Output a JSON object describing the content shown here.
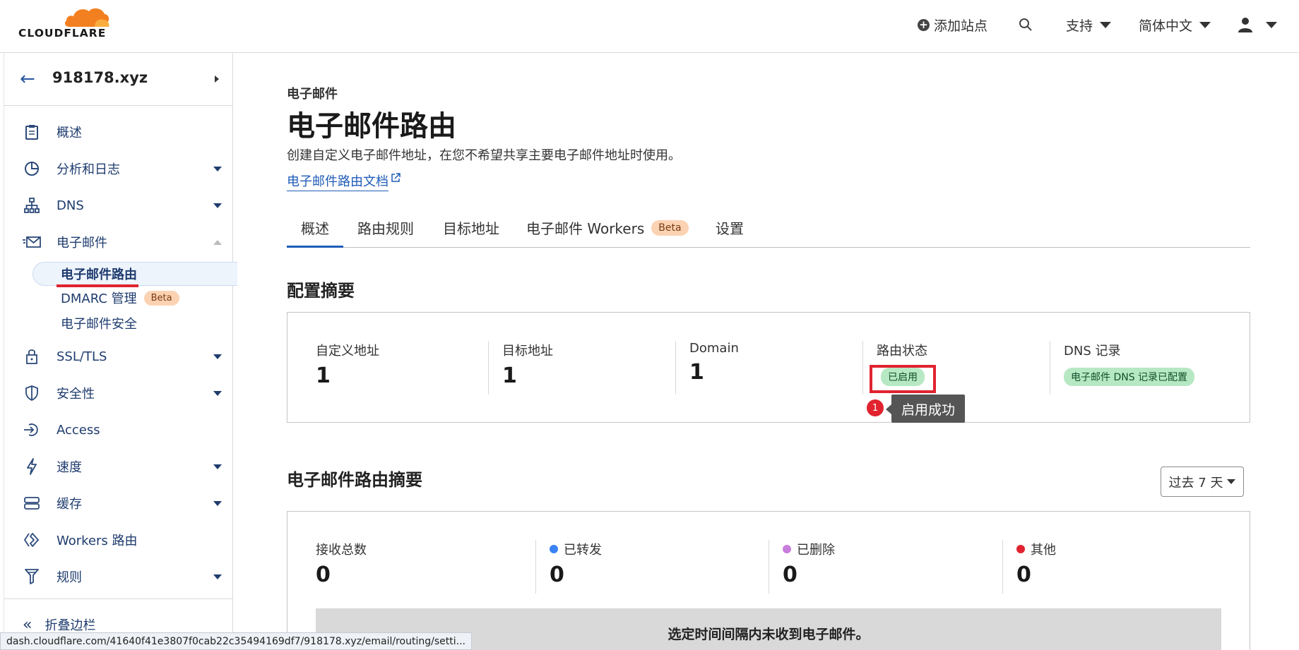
{
  "header": {
    "logo_text": "CLOUDFLARE",
    "add_site_label": "添加站点",
    "support_label": "支持",
    "language_label": "简体中文"
  },
  "sidebar": {
    "zone_name": "918178.xyz",
    "items": [
      {
        "label": "概述",
        "icon": "clipboard-icon"
      },
      {
        "label": "分析和日志",
        "icon": "analytics-icon"
      },
      {
        "label": "DNS",
        "icon": "network-icon"
      },
      {
        "label": "电子邮件",
        "icon": "email-icon"
      },
      {
        "label": "SSL/TLS",
        "icon": "lock-icon"
      },
      {
        "label": "安全性",
        "icon": "shield-icon"
      },
      {
        "label": "Access",
        "icon": "access-icon"
      },
      {
        "label": "速度",
        "icon": "lightning-icon"
      },
      {
        "label": "缓存",
        "icon": "cache-icon"
      },
      {
        "label": "Workers 路由",
        "icon": "workers-icon"
      },
      {
        "label": "规则",
        "icon": "rules-icon"
      }
    ],
    "email_sub": {
      "routing": "电子邮件路由",
      "dmarc": "DMARC 管理",
      "dmarc_badge": "Beta",
      "security": "电子邮件安全"
    },
    "collapse_label": "折叠边栏"
  },
  "main": {
    "breadcrumb": "电子邮件",
    "title": "电子邮件路由",
    "description": "创建自定义电子邮件地址，在您不希望共享主要电子邮件地址时使用。",
    "doc_link": "电子邮件路由文档",
    "tabs": [
      {
        "label": "概述"
      },
      {
        "label": "路由规则"
      },
      {
        "label": "目标地址"
      },
      {
        "label": "电子邮件 Workers",
        "badge": "Beta"
      },
      {
        "label": "设置"
      }
    ]
  },
  "config_summary": {
    "title": "配置摘要",
    "custom_addresses_label": "自定义地址",
    "custom_addresses_value": "1",
    "destination_label": "目标地址",
    "destination_value": "1",
    "domain_label": "Domain",
    "domain_value": "1",
    "routing_status_label": "路由状态",
    "routing_status_value": "已启用",
    "dns_label": "DNS 记录",
    "dns_value": "电子邮件 DNS 记录已配置"
  },
  "tooltip": {
    "step": "1",
    "text": "启用成功"
  },
  "routing_summary": {
    "title": "电子邮件路由摘要",
    "range_label": "过去 7 天",
    "total_label": "接收总数",
    "total_value": "0",
    "forwarded_label": "已转发",
    "forwarded_value": "0",
    "forwarded_color": "#3b82f6",
    "deleted_label": "已删除",
    "deleted_value": "0",
    "deleted_color": "#c77ddb",
    "other_label": "其他",
    "other_value": "0",
    "other_color": "#e0232f",
    "empty_message": "选定时间间隔内未收到电子邮件。"
  },
  "statusbar": {
    "url": "dash.cloudflare.com/41640f41e3807f0cab22c35494169df7/918178.xyz/email/routing/setti..."
  }
}
